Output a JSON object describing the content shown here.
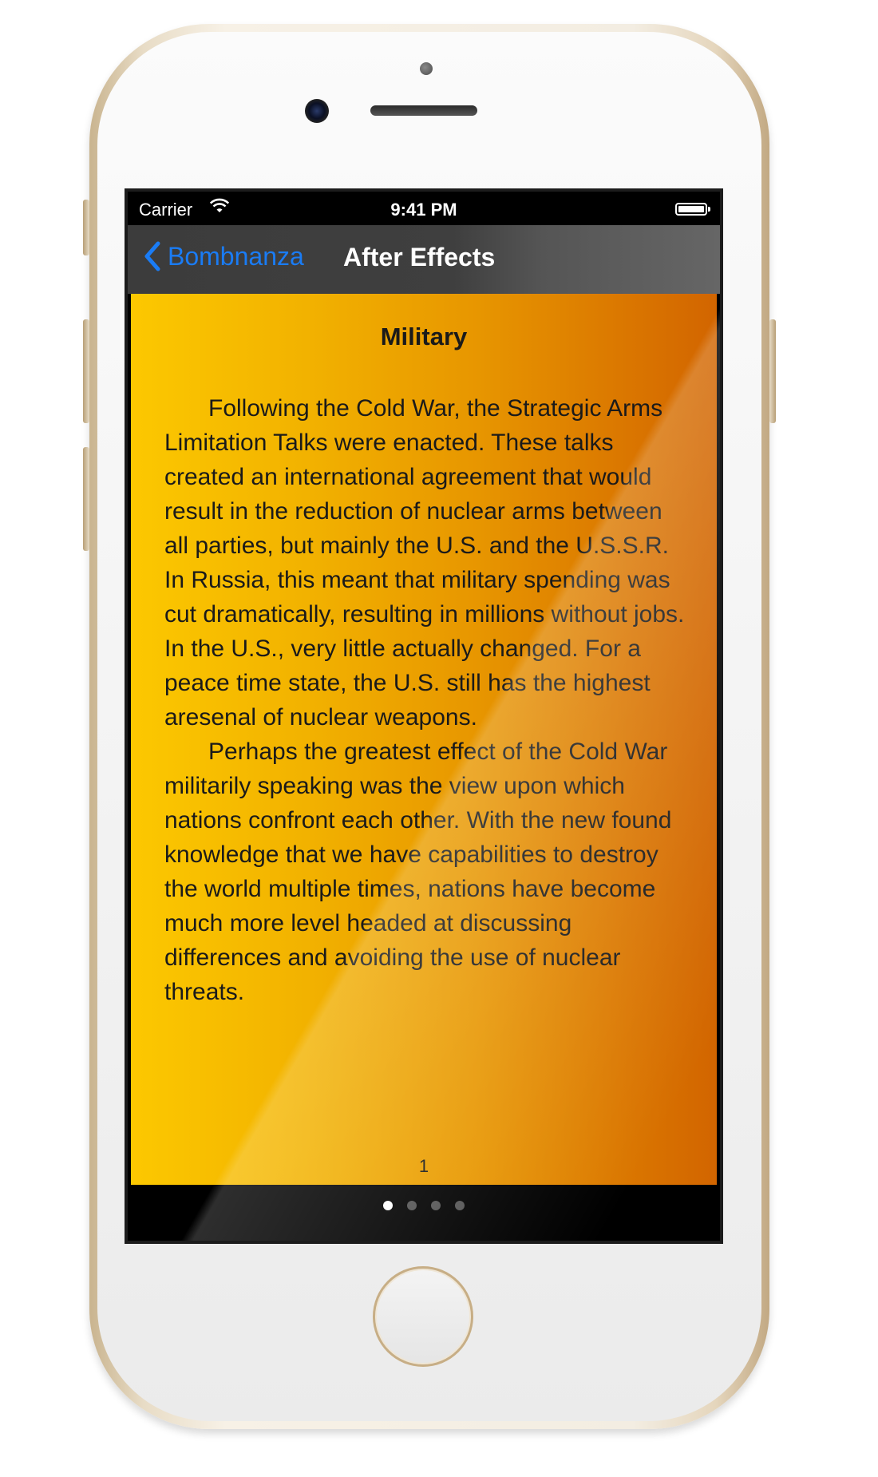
{
  "status_bar": {
    "carrier": "Carrier",
    "time": "9:41 PM"
  },
  "nav": {
    "back_label": "Bombnanza",
    "title": "After Effects"
  },
  "page": {
    "heading": "Military",
    "paragraphs": [
      "Following the Cold War, the Strategic Arms Limitation Talks were enacted. These talks created an international agreement that would result in the reduction of nuclear arms between all parties, but mainly the U.S. and the U.S.S.R. In Russia, this meant that military spending was cut dramatically, resulting in millions without jobs. In the U.S., very little actually changed. For a peace time state, the U.S. still has the highest aresenal of nuclear weapons.",
      "Perhaps the greatest effect of the Cold War militarily speaking was the view upon which nations confront each other. With the new found knowledge that we have capabilities to destroy the world multiple times, nations have become much more level headed at discussing differences and avoiding the use of nuclear threats."
    ],
    "page_number": "1"
  },
  "page_control": {
    "page_count": 4,
    "current_index": 0
  },
  "colors": {
    "accent": "#1a7cf5",
    "page_gradient_start": "#fcc800",
    "page_gradient_end": "#d26500"
  },
  "icons": {
    "back": "chevron-left-icon",
    "wifi": "wifi-icon",
    "battery": "battery-icon"
  }
}
